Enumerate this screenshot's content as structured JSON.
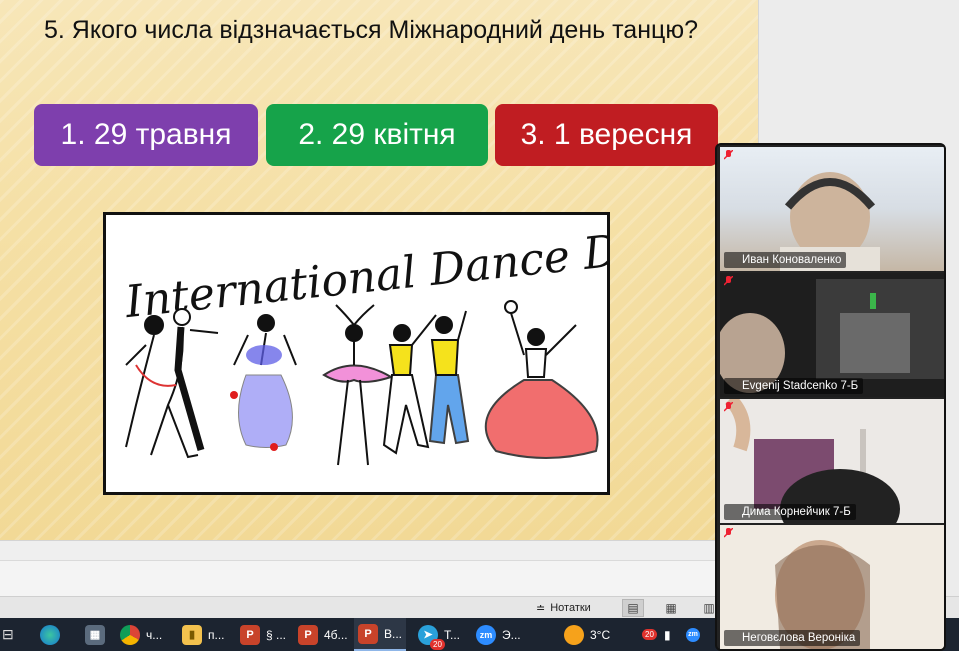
{
  "slide": {
    "question": "5. Якого числа відзначається Міжнародний день танцю?",
    "answers": [
      {
        "label": "1. 29 травня",
        "color": "#7e3fad"
      },
      {
        "label": "2. 29 квітня",
        "color": "#16a34a"
      },
      {
        "label": "3. 1 вересня",
        "color": "#c01d22"
      }
    ],
    "image_text": "International Dance Day"
  },
  "status_bar": {
    "notes_label": "Нотатки"
  },
  "video_tiles": [
    {
      "name": "Иван Коноваленко"
    },
    {
      "name": "Evgenij Stadcenko 7-Б"
    },
    {
      "name": "Дима Корнейчик 7-Б"
    },
    {
      "name": "Неговєлова Вероніка"
    }
  ],
  "taskbar": {
    "items": [
      {
        "label": "ч..."
      },
      {
        "label": "п..."
      },
      {
        "label": "§ ..."
      },
      {
        "label": "4б..."
      },
      {
        "label": "В..."
      },
      {
        "label": "Т..."
      },
      {
        "label": "Э..."
      }
    ],
    "telegram_badge": "20",
    "weather": "3°C",
    "tray_badge": "20"
  }
}
